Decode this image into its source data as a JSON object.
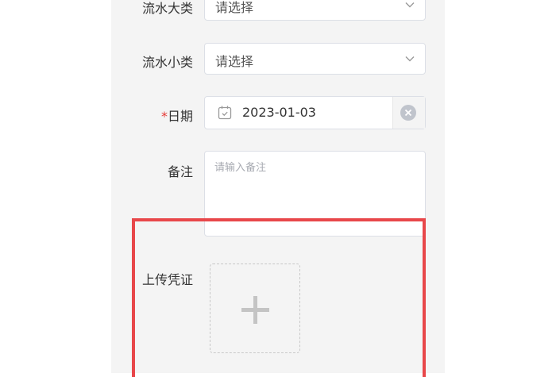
{
  "form": {
    "category_label": "流水大类",
    "category_value": "请选择",
    "subcategory_label": "流水小类",
    "subcategory_value": "请选择",
    "date_required_mark": "*",
    "date_label": "日期",
    "date_value": "2023-01-03",
    "remark_label": "备注",
    "remark_placeholder": "请输入备注",
    "upload_label": "上传凭证"
  },
  "icons": {
    "category_chevron": "chevron-down-icon",
    "subcategory_chevron": "chevron-down-icon",
    "calendar": "calendar-icon",
    "clear": "clear-icon",
    "upload": "plus-icon"
  },
  "colors": {
    "highlight_border": "#e8474a",
    "required_mark": "#e53935",
    "panel_background": "#f4f4f4"
  }
}
